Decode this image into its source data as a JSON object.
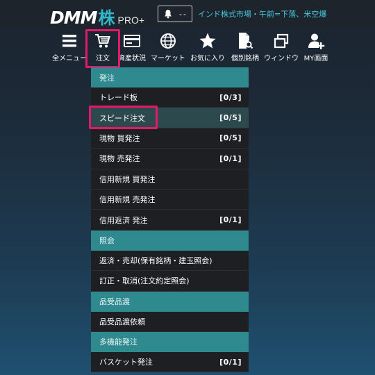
{
  "header": {
    "logo_main": "DMM",
    "logo_kabu": "株",
    "logo_pro": "PRO+",
    "notification_count": "--",
    "ticker": "インド株式市場・午前=下落、米空爆"
  },
  "toolbar": {
    "items": [
      {
        "label": "全メニュー",
        "icon": "hamburger-menu-icon"
      },
      {
        "label": "注文",
        "icon": "cart-icon"
      },
      {
        "label": "資産状況",
        "icon": "wallet-card-icon"
      },
      {
        "label": "マーケット",
        "icon": "globe-icon"
      },
      {
        "label": "お気に入り",
        "icon": "star-icon"
      },
      {
        "label": "個別銘柄",
        "icon": "document-search-icon"
      },
      {
        "label": "ウィンドウ",
        "icon": "windows-icon"
      },
      {
        "label": "MY画面",
        "icon": "user-add-icon"
      }
    ]
  },
  "menu": {
    "sections": [
      {
        "title": "発注",
        "items": [
          {
            "label": "トレード板",
            "count": "[0/3]"
          },
          {
            "label": "スピード注文",
            "count": "[0/5]"
          },
          {
            "label": "現物 買発注",
            "count": "[0/5]"
          },
          {
            "label": "現物 売発注",
            "count": "[0/1]"
          },
          {
            "label": "信用新規 買発注",
            "count": ""
          },
          {
            "label": "信用新規 売発注",
            "count": ""
          },
          {
            "label": "信用返済 発注",
            "count": "[0/1]"
          }
        ]
      },
      {
        "title": "照会",
        "items": [
          {
            "label": "返済・売却(保有銘柄・建玉照会)",
            "count": ""
          },
          {
            "label": "訂正・取消(注文約定照会)",
            "count": ""
          }
        ]
      },
      {
        "title": "品受品渡",
        "items": [
          {
            "label": "品受品渡依頼",
            "count": ""
          }
        ]
      },
      {
        "title": "多機能発注",
        "items": [
          {
            "label": "バスケット発注",
            "count": "[0/1]"
          }
        ]
      }
    ]
  },
  "colors": {
    "accent_teal": "#2f8a8f",
    "highlight_pink": "#e5196a",
    "ticker_cyan": "#45c8e0"
  }
}
